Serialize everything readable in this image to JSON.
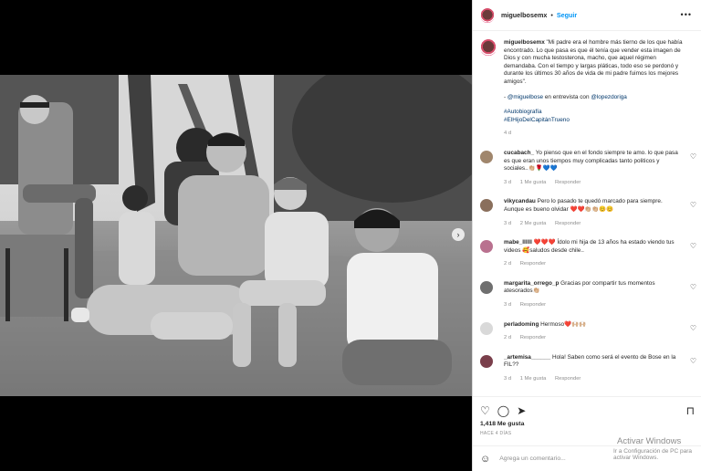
{
  "post": {
    "username": "miguelbosemx",
    "dot": "•",
    "follow_label": "Seguir",
    "more_label": "•••",
    "nav_next": "›"
  },
  "caption": {
    "username": "miguelbosemx",
    "text": "\"Mi padre era el hombre más tierno de los que había encontrado. Lo que pasa es que él tenía que vender esta imagen de Dios y con mucha testosterona, macho, que aquel régimen demandaba. Con el tiempo y largas pláticas, todo eso se perdonó y durante los últimos 30 años de vida de mi padre fuimos los mejores amigos\".",
    "credit_prefix": "- ",
    "credit_handle1": "@miguelbose",
    "credit_mid": " en entrevista con ",
    "credit_handle2": "@lopezdoriga",
    "tag1": "#Autobiografía",
    "tag2": "#ElHijoDelCapitánTrueno",
    "time": "4 d"
  },
  "comments": [
    {
      "username": "cucabach_",
      "text": "Yo pienso que en el fondo siempre te amo. lo que pasa es que eran unos tiempos muy complicadas tanto politicos y sociales..👏🏼🌹💙💙",
      "time": "3 d",
      "likes": "1 Me gusta",
      "reply": "Responder",
      "avatar_color": "#a0866c"
    },
    {
      "username": "vikycandau",
      "text": "Pero lo pasado te quedó marcado para siempre. Aunque es bueno olvidar ❤️❤️👏🏼👏🏼😊😊",
      "time": "3 d",
      "likes": "2 Me gusta",
      "reply": "Responder",
      "avatar_color": "#8a6f5c"
    },
    {
      "username": "mabe_llllll",
      "text": "❤️❤️❤️ Ídolo mi hija de 13 años ha estado viendo tus videos 🥰saludos desde chile..",
      "time": "2 d",
      "likes": "",
      "reply": "Responder",
      "avatar_color": "#b9718f"
    },
    {
      "username": "margarita_orrego_p",
      "text": "Gracias por compartir tus momentos atesorados👏🏼",
      "time": "3 d",
      "likes": "",
      "reply": "Responder",
      "avatar_color": "#6f6f6f"
    },
    {
      "username": "perladoming",
      "text": "Hermoso❤️🙌🏼🙌🏼",
      "time": "2 d",
      "likes": "",
      "reply": "Responder",
      "avatar_color": "#d9d9d9"
    },
    {
      "username": "_artemisa______",
      "text": "Hola! Saben como será el evento de Bose en la FIL??",
      "time": "3 d",
      "likes": "1 Me gusta",
      "reply": "Responder",
      "avatar_color": "#7a3f4b"
    }
  ],
  "actions": {
    "like_icon": "♡",
    "comment_icon": "◯",
    "share_icon": "➤",
    "save_icon": "⊓",
    "heart": "♡",
    "likes_count": "1,418 Me gusta",
    "ago": "HACE 4 DÍAS",
    "add_comment_placeholder": "Agrega un comentario..."
  },
  "watermark": {
    "line1": "Activar Windows",
    "line2": "Ir a Configuración de PC para activar Windows."
  }
}
